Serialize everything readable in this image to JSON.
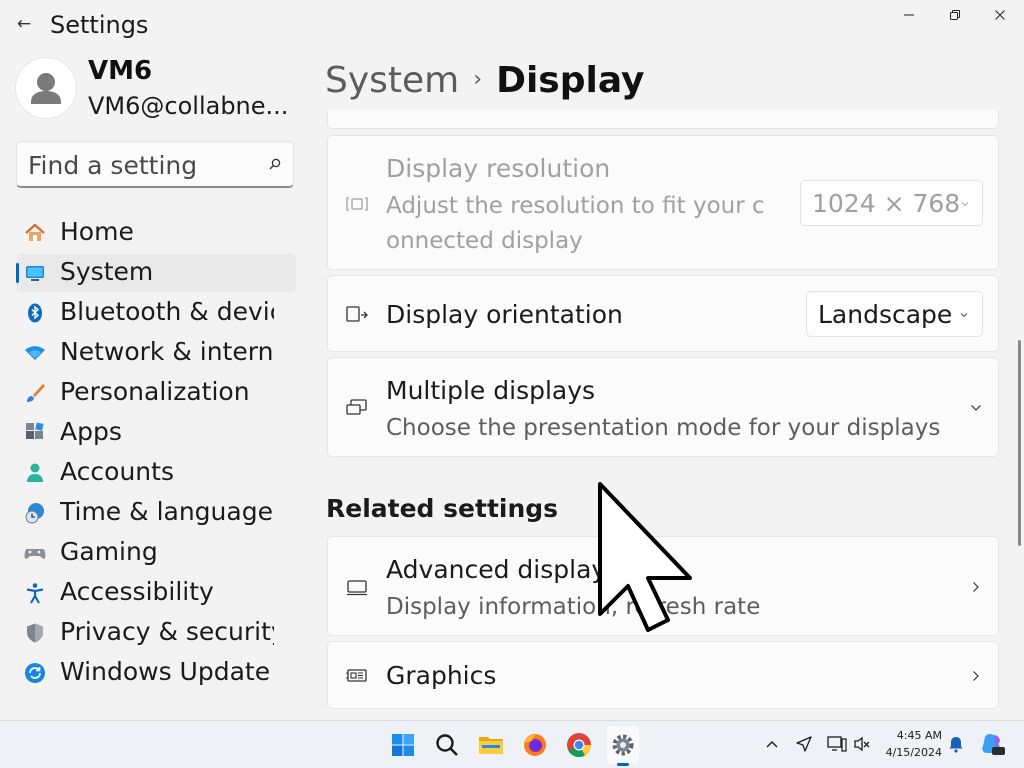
{
  "window": {
    "title": "Settings",
    "back_icon": "back-arrow-icon",
    "controls": [
      "minimize-icon",
      "maximize-icon",
      "close-icon"
    ]
  },
  "profile": {
    "name": "VM6",
    "email": "VM6@collabne..."
  },
  "search": {
    "placeholder": "Find a setting"
  },
  "nav": {
    "items": [
      {
        "label": "Home",
        "icon": "home-icon"
      },
      {
        "label": "System",
        "icon": "system-icon",
        "active": true
      },
      {
        "label": "Bluetooth & devices",
        "icon": "bluetooth-icon"
      },
      {
        "label": "Network & internet",
        "icon": "network-icon"
      },
      {
        "label": "Personalization",
        "icon": "brush-icon"
      },
      {
        "label": "Apps",
        "icon": "apps-icon"
      },
      {
        "label": "Accounts",
        "icon": "accounts-icon"
      },
      {
        "label": "Time & language",
        "icon": "time-language-icon"
      },
      {
        "label": "Gaming",
        "icon": "gaming-icon"
      },
      {
        "label": "Accessibility",
        "icon": "accessibility-icon"
      },
      {
        "label": "Privacy & security",
        "icon": "shield-icon"
      },
      {
        "label": "Windows Update",
        "icon": "windows-update-icon"
      }
    ]
  },
  "breadcrumb": {
    "parent": "System",
    "separator": "›",
    "current": "Display"
  },
  "cards": {
    "resolution": {
      "title": "Display resolution",
      "desc_line1": "Adjust the resolution to fit your c",
      "desc_line2": "onnected display",
      "value": "1024 × 768",
      "disabled": true
    },
    "orientation": {
      "title": "Display orientation",
      "value": "Landscape"
    },
    "multiple": {
      "title": "Multiple displays",
      "desc": "Choose the presentation mode for your displays"
    },
    "advanced": {
      "title": "Advanced display",
      "desc": "Display information, refresh rate"
    },
    "graphics": {
      "title": "Graphics"
    }
  },
  "related_settings": {
    "header": "Related settings"
  },
  "taskbar": {
    "apps": [
      "windows-start-icon",
      "search-icon",
      "file-explorer-icon",
      "firefox-icon",
      "chrome-icon",
      "settings-gear-icon"
    ],
    "time": "4:45 AM",
    "date": "4/15/2024",
    "colors": {
      "accent": "#0067c0",
      "background": "#eef1f5"
    }
  }
}
